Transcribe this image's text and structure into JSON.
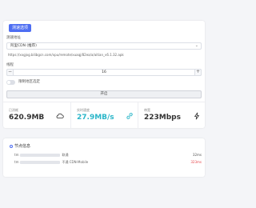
{
  "main": {
    "badge": "测速选项",
    "source_label": "测速地址",
    "source_selected": "阿里CDN (推荐)",
    "url": "https://xxgjxg.bilibgcn.com/xpu/remote/xuaqj/82ea/a/aitian_v6.1.32.apk",
    "threads_label": "线程",
    "threads_value": "16",
    "minus": "−",
    "plus": "+",
    "toggle_label": "限制地区选定",
    "start_label": "开启"
  },
  "stats": [
    {
      "label": "已消耗",
      "value": "620.9MB",
      "icon": "cloud-icon"
    },
    {
      "label": "实时速度",
      "value": "27.9MB/s",
      "icon": "link-icon"
    },
    {
      "label": "带宽",
      "value": "223Mbps",
      "icon": "lightning-icon"
    }
  ],
  "nodes": {
    "title": "节点信息",
    "rows": [
      {
        "prefix": "tm",
        "suffix": "联通",
        "latency": "32ms",
        "color": "#555555"
      },
      {
        "prefix": "tm",
        "suffix": "不通 CDN-Mobile",
        "latency": "323ms",
        "color": "#e5484d"
      }
    ]
  },
  "colors": {
    "accent": "#4e6ef2",
    "speed": "#2bb6c9",
    "warn": "#e5484d"
  }
}
